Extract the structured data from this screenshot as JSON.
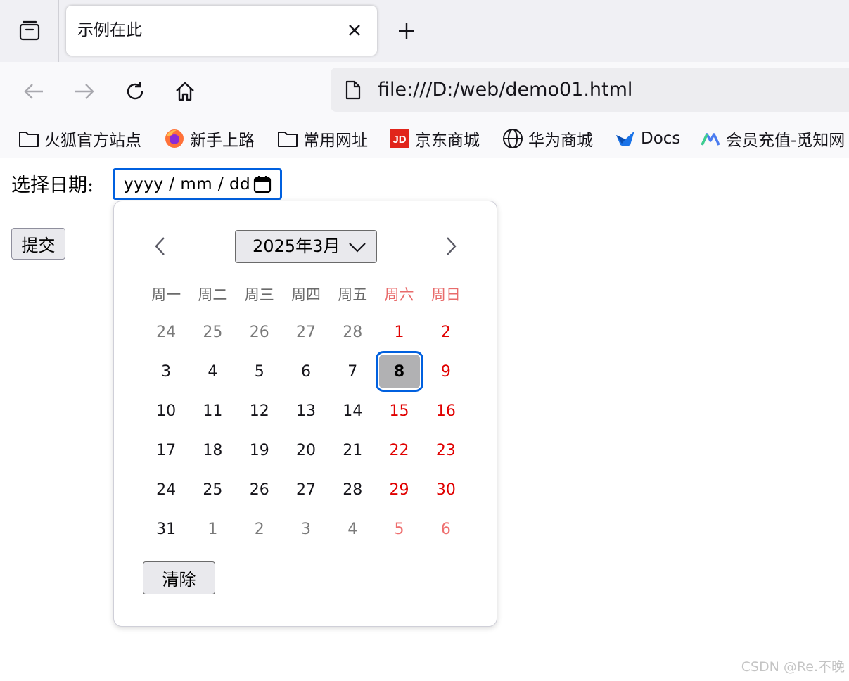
{
  "tabs": {
    "overview_icon": "tab-overview-icon",
    "active_title": "示例在此",
    "close_icon": "close-icon",
    "new_tab_icon": "plus-icon"
  },
  "navbar": {
    "back_icon": "arrow-left-icon",
    "forward_icon": "arrow-right-icon",
    "reload_icon": "reload-icon",
    "home_icon": "home-icon",
    "url": "file:///D:/web/demo01.html"
  },
  "bookmarks": [
    {
      "label": "火狐官方站点",
      "icon": "folder-icon"
    },
    {
      "label": "新手上路",
      "icon": "firefox-icon"
    },
    {
      "label": "常用网址",
      "icon": "folder-icon"
    },
    {
      "label": "京东商城",
      "icon": "jd-icon"
    },
    {
      "label": "华为商城",
      "icon": "globe-icon"
    },
    {
      "label": "Docs",
      "icon": "docs-icon"
    },
    {
      "label": "会员充值-觅知网",
      "icon": "mizhi-icon"
    }
  ],
  "form": {
    "date_label": "选择日期:",
    "date_placeholder": "yyyy / mm / dd",
    "submit_label": "提交"
  },
  "picker": {
    "month_label": "2025年3月",
    "weekdays": [
      "周一",
      "周二",
      "周三",
      "周四",
      "周五",
      "周六",
      "周日"
    ],
    "weeks": [
      [
        "24",
        "25",
        "26",
        "27",
        "28",
        "1",
        "2"
      ],
      [
        "3",
        "4",
        "5",
        "6",
        "7",
        "8",
        "9"
      ],
      [
        "10",
        "11",
        "12",
        "13",
        "14",
        "15",
        "16"
      ],
      [
        "17",
        "18",
        "19",
        "20",
        "21",
        "22",
        "23"
      ],
      [
        "24",
        "25",
        "26",
        "27",
        "28",
        "29",
        "30"
      ],
      [
        "31",
        "1",
        "2",
        "3",
        "4",
        "5",
        "6"
      ]
    ],
    "selected_day": "8",
    "clear_label": "清除"
  },
  "watermark": "CSDN @Re.不晚",
  "colors": {
    "accent": "#0060df",
    "weekend": "#e00000",
    "selected_bg": "#b1b1b3"
  }
}
